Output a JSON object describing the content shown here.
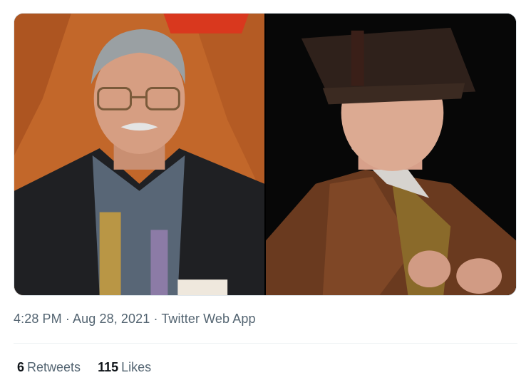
{
  "tweet": {
    "media": {
      "left_photo": "man with glasses and mustache holding award",
      "right_photo": "man in brown robe and tassel hat"
    },
    "time": "4:28 PM",
    "date": "Aug 28, 2021",
    "source": "Twitter Web App",
    "separator": " · ",
    "stats": {
      "retweets_count": "6",
      "retweets_label": "Retweets",
      "likes_count": "115",
      "likes_label": "Likes"
    }
  }
}
